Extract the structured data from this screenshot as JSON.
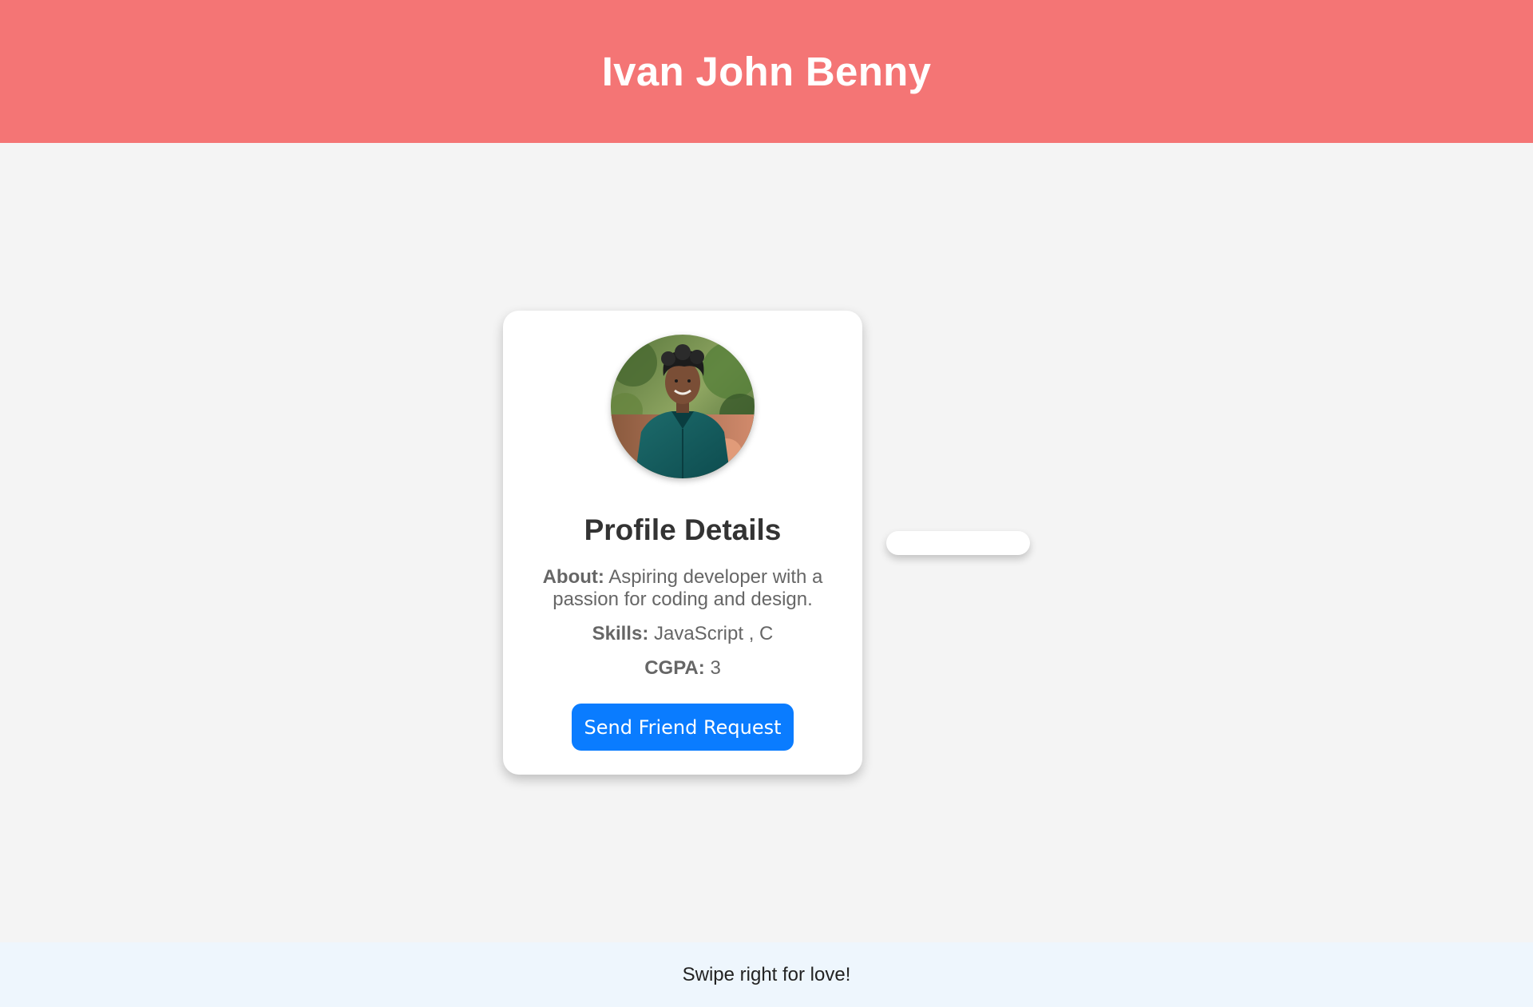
{
  "header": {
    "title": "Ivan John Benny"
  },
  "profile_card": {
    "title": "Profile Details",
    "about_label": "About:",
    "about_text": "Aspiring developer with a passion for coding and design.",
    "skills_label": "Skills:",
    "skills_text": "JavaScript , C",
    "cgpa_label": "CGPA:",
    "cgpa_text": "3",
    "button_label": "Send Friend Request"
  },
  "footer": {
    "text": "Swipe right for love!"
  },
  "colors": {
    "header_background": "#f47575",
    "button_background": "#0a7cff",
    "page_background": "#f4f4f4",
    "footer_background": "#eef6fd"
  }
}
